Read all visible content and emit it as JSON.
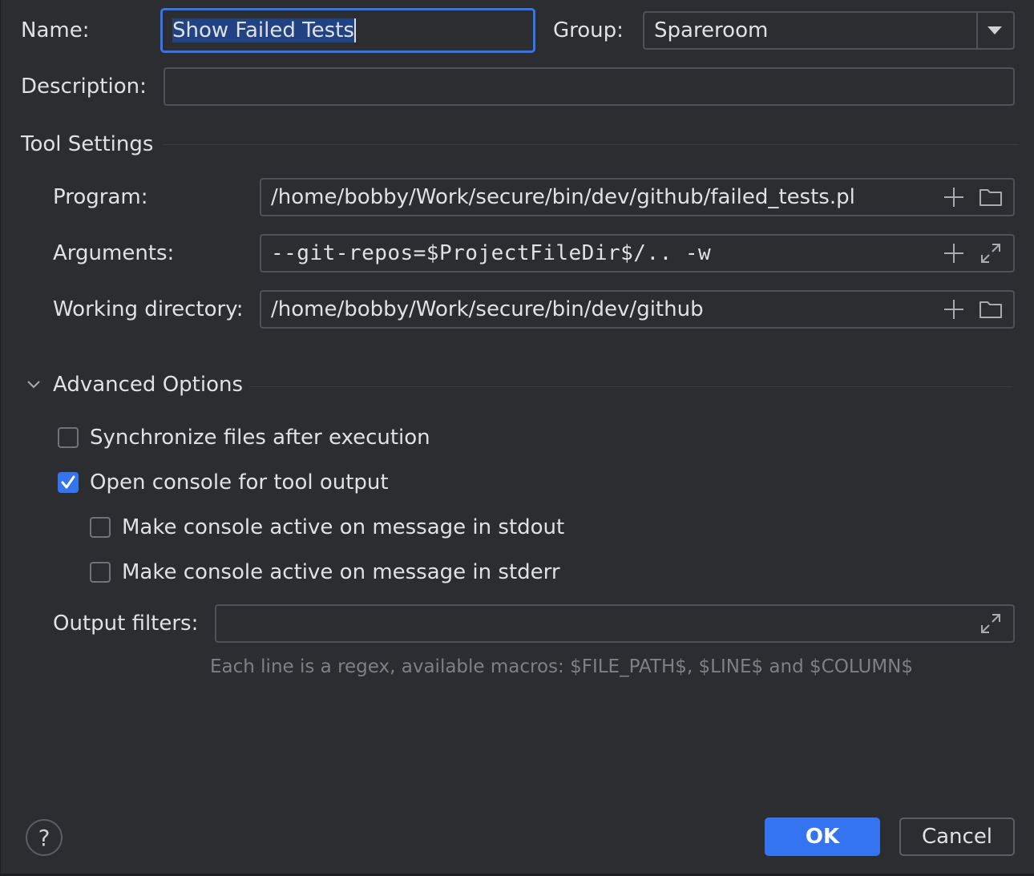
{
  "form": {
    "name_label": "Name:",
    "name_value": "Show Failed Tests",
    "group_label": "Group:",
    "group_value": "Spareroom",
    "description_label": "Description:",
    "description_value": ""
  },
  "tool_settings": {
    "title": "Tool Settings",
    "program_label": "Program:",
    "program_value": "/home/bobby/Work/secure/bin/dev/github/failed_tests.pl",
    "arguments_label": "Arguments:",
    "arguments_value": "--git-repos=$ProjectFileDir$/.. -w",
    "working_dir_label": "Working directory:",
    "working_dir_value": "/home/bobby/Work/secure/bin/dev/github"
  },
  "advanced": {
    "title": "Advanced Options",
    "expanded": true,
    "options": [
      {
        "label": "Synchronize files after execution",
        "checked": false
      },
      {
        "label": "Open console for tool output",
        "checked": true
      },
      {
        "label": "Make console active on message in stdout",
        "checked": false
      },
      {
        "label": "Make console active on message in stderr",
        "checked": false
      }
    ],
    "output_filters_label": "Output filters:",
    "output_filters_value": "",
    "hint": "Each line is a regex, available macros: $FILE_PATH$, $LINE$ and $COLUMN$"
  },
  "buttons": {
    "ok": "OK",
    "cancel": "Cancel",
    "help": "?"
  },
  "colors": {
    "accent": "#3574f0",
    "background": "#2b2d30",
    "selection": "#214283"
  },
  "icons": [
    "plus-icon",
    "folder-icon",
    "expand-icon",
    "chevron-down-icon",
    "checkmark-icon",
    "help-icon"
  ]
}
